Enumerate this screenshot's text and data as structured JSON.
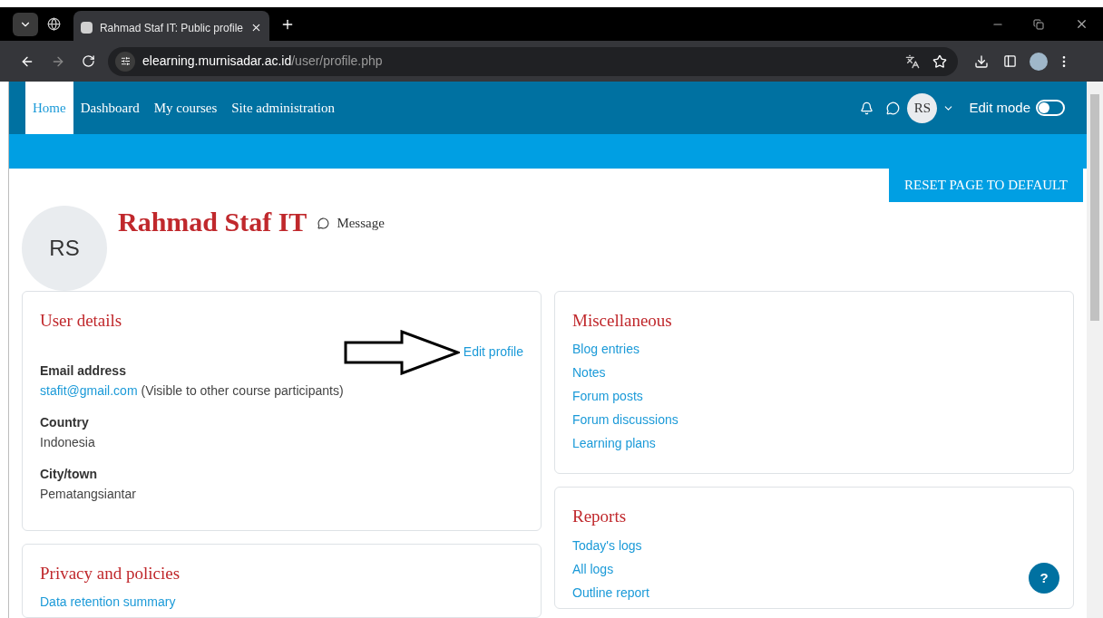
{
  "browser": {
    "tab_title": "Rahmad Staf IT: Public profile",
    "url_host": "elearning.murnisadar.ac.id",
    "url_path": "/user/profile.php"
  },
  "navbar": {
    "items": [
      {
        "label": "Home",
        "selected": true
      },
      {
        "label": "Dashboard",
        "selected": false
      },
      {
        "label": "My courses",
        "selected": false
      },
      {
        "label": "Site administration",
        "selected": false
      }
    ],
    "avatar_initials": "RS",
    "edit_mode": {
      "label": "Edit mode",
      "on": false
    }
  },
  "reset_button": "RESET PAGE TO DEFAULT",
  "profile": {
    "initials": "RS",
    "name": "Rahmad Staf IT",
    "message": "Message"
  },
  "user_details": {
    "title": "User details",
    "edit_link": "Edit profile",
    "fields": [
      {
        "label": "Email address",
        "link": "stafit@gmail.com",
        "note": "(Visible to other course participants)"
      },
      {
        "label": "Country",
        "value": "Indonesia"
      },
      {
        "label": "City/town",
        "value": "Pematangsiantar"
      }
    ]
  },
  "privacy": {
    "title": "Privacy and policies",
    "links": [
      "Data retention summary"
    ]
  },
  "miscellaneous": {
    "title": "Miscellaneous",
    "links": [
      "Blog entries",
      "Notes",
      "Forum posts",
      "Forum discussions",
      "Learning plans"
    ]
  },
  "reports": {
    "title": "Reports",
    "links": [
      "Today's logs",
      "All logs",
      "Outline report"
    ]
  },
  "help_button": "?"
}
